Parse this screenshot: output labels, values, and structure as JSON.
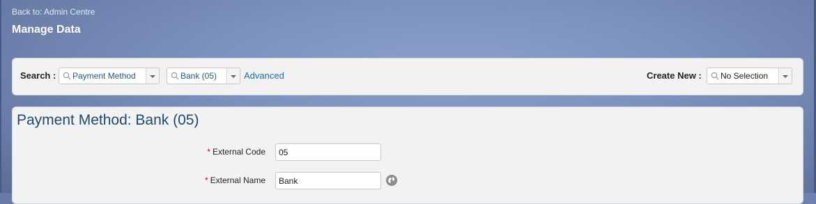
{
  "header": {
    "back_link": "Back to: Admin Centre",
    "title": "Manage Data"
  },
  "search": {
    "label": "Search :",
    "type_value": "Payment Method",
    "item_value": "Bank (05)",
    "advanced_link": "Advanced"
  },
  "create_new": {
    "label": "Create New :",
    "value": "No Selection"
  },
  "detail": {
    "heading": "Payment Method: Bank (05)",
    "fields": [
      {
        "label": "External Code",
        "value": "05",
        "required": "*"
      },
      {
        "label": "External Name",
        "value": "Bank",
        "required": "*"
      }
    ]
  },
  "colors": {
    "link": "#1f6bb0",
    "required": "#d0021b",
    "heading": "#1f4a6b"
  },
  "icons": [
    "search-icon",
    "chevron-down-icon",
    "globe-icon"
  ]
}
